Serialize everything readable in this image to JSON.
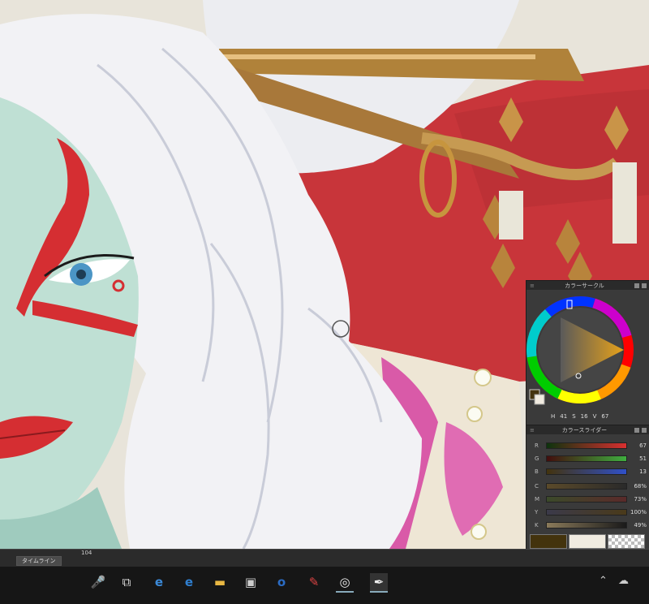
{
  "color_circle": {
    "title": "カラーサークル",
    "h": "41",
    "s": "16",
    "v": "67"
  },
  "color_slider": {
    "title": "カラースライダー",
    "rgb": [
      {
        "label": "R",
        "value": "67"
      },
      {
        "label": "G",
        "value": "51"
      },
      {
        "label": "B",
        "value": "13"
      }
    ],
    "cmyk": [
      {
        "label": "C",
        "value": "68%"
      },
      {
        "label": "M",
        "value": "73%"
      },
      {
        "label": "Y",
        "value": "100%"
      },
      {
        "label": "K",
        "value": "49%"
      }
    ]
  },
  "status_bar": {
    "zoom": "104",
    "timeline_tab": "タイムライン"
  },
  "taskbar": {
    "icons": [
      "microphone-icon",
      "task-view-icon",
      "ie-icon",
      "edge-icon",
      "file-explorer-icon",
      "store-icon",
      "outlook-icon",
      "paint-icon",
      "clip-studio-icon",
      "clip-studio-paint-icon"
    ],
    "tray": [
      "chevron-up-icon",
      "onedrive-icon"
    ]
  },
  "colors": {
    "main_color": "#43330d",
    "sub_color": "#f0ebe0",
    "transparent": "checker"
  }
}
